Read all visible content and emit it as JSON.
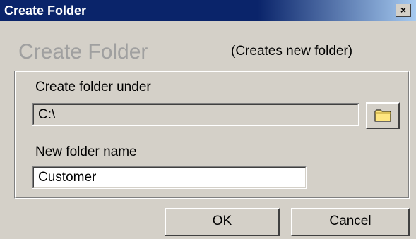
{
  "window": {
    "title": "Create Folder",
    "close_glyph": "×"
  },
  "heading": "Create Folder",
  "subheading": "(Creates new folder)",
  "parent_folder": {
    "label": "Create folder under",
    "value": "C:\\",
    "browse_icon": "folder-icon"
  },
  "folder_name": {
    "label": "New folder name",
    "value": "Customer"
  },
  "buttons": {
    "ok": {
      "mnemonic": "O",
      "rest": "K"
    },
    "cancel": {
      "mnemonic": "C",
      "rest": "ancel"
    }
  },
  "colors": {
    "titlebar_start": "#0a246a",
    "titlebar_end": "#a6caf0",
    "face": "#d4d0c8",
    "heading": "#a0a0a0",
    "folder_icon": "#ffe680"
  }
}
